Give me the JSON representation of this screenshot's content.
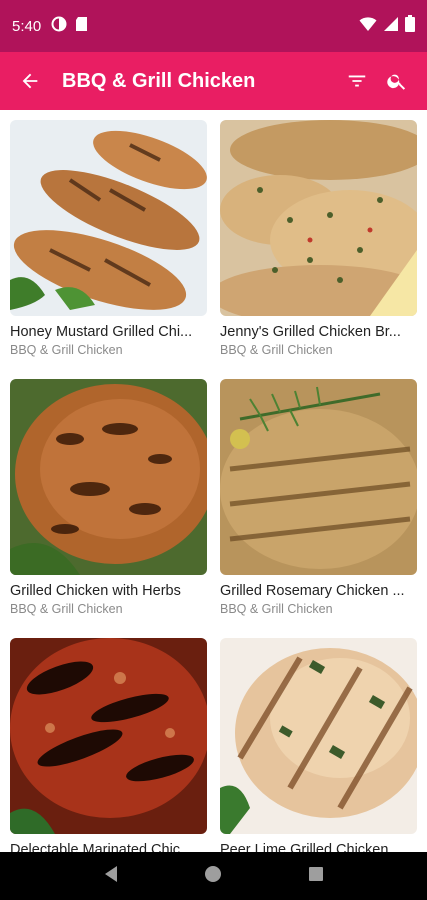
{
  "status_bar": {
    "time": "5:40",
    "colors": {
      "background": "#b0135a"
    }
  },
  "app_bar": {
    "title": "BBQ & Grill Chicken",
    "colors": {
      "background": "#e91e63"
    }
  },
  "recipes": [
    {
      "title": "Honey Mustard Grilled Chi...",
      "category": "BBQ & Grill Chicken"
    },
    {
      "title": "Jenny's Grilled Chicken Br...",
      "category": "BBQ & Grill Chicken"
    },
    {
      "title": "Grilled Chicken with Herbs",
      "category": "BBQ & Grill Chicken"
    },
    {
      "title": "Grilled Rosemary Chicken ...",
      "category": "BBQ & Grill Chicken"
    },
    {
      "title": "Delectable Marinated Chic...",
      "category": ""
    },
    {
      "title": "Peer Lime Grilled Chicken",
      "category": ""
    }
  ]
}
